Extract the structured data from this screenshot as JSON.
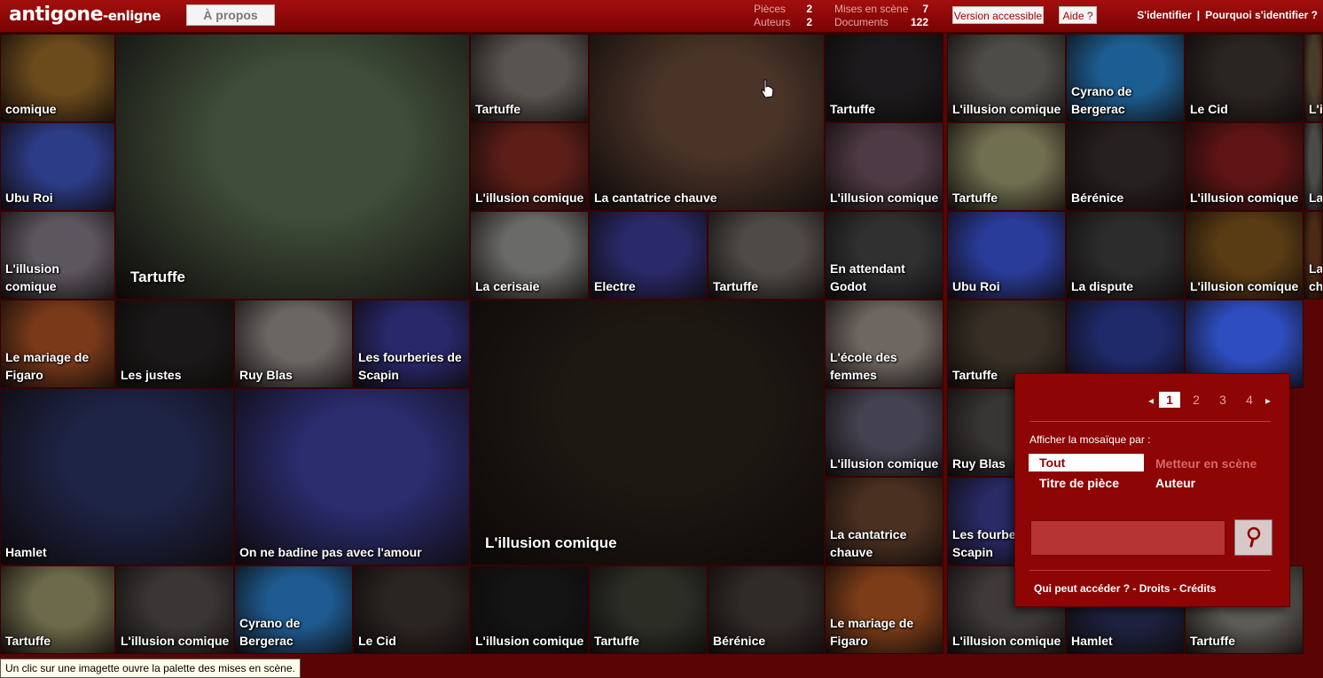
{
  "header": {
    "logo_main": "antigone",
    "logo_suffix": "-enligne",
    "about_button": "À propos",
    "stats": [
      {
        "label": "Pièces",
        "value": "2"
      },
      {
        "label": "Auteurs",
        "value": "2"
      },
      {
        "label": "Mises en scène",
        "value": "7"
      },
      {
        "label": "Documents",
        "value": "122"
      }
    ],
    "accessible_button": "Version accessible",
    "help_button": "Aide ?",
    "login_link": "S'identifier",
    "separator": "|",
    "why_login_link": "Pourquoi s'identifier ?"
  },
  "tiles": [
    {
      "label": "comique",
      "color": "#6b4a1c"
    },
    {
      "label": "Tartuffe",
      "color": "#3f4d39"
    },
    {
      "label": "Tartuffe",
      "color": "#5a5450"
    },
    {
      "label": "La cantatrice chauve",
      "color": "#4a3428"
    },
    {
      "label": "Tartuffe",
      "color": "#1c1a1c"
    },
    {
      "label": "L'illusion comique",
      "color": "#4e4c48"
    },
    {
      "label": "Cyrano de Bergerac",
      "color": "#1d5e92"
    },
    {
      "label": "Le Cid",
      "color": "#2a2422"
    },
    {
      "label": "L'i",
      "color": "#4a3c2a"
    },
    {
      "label": "Ubu Roi",
      "color": "#2d3c86"
    },
    {
      "label": "L'illusion comique",
      "color": "#5e1e18"
    },
    {
      "label": "L'illusion comique",
      "color": "#4e3a44"
    },
    {
      "label": "Tartuffe",
      "color": "#6e7050"
    },
    {
      "label": "Bérénice",
      "color": "#262020"
    },
    {
      "label": "L'illusion comique",
      "color": "#5e1414"
    },
    {
      "label": "La",
      "color": "#4a4a48"
    },
    {
      "label": "L'illusion comique",
      "color": "#5c565e"
    },
    {
      "label": "La cerisaie",
      "color": "#6a6a68"
    },
    {
      "label": "Electre",
      "color": "#2a2a6a"
    },
    {
      "label": "Tartuffe",
      "color": "#4e4a46"
    },
    {
      "label": "En attendant Godot",
      "color": "#303030"
    },
    {
      "label": "Ubu Roi",
      "color": "#2a3c9a"
    },
    {
      "label": "La dispute",
      "color": "#2c2c2c"
    },
    {
      "label": "L'illusion comique",
      "color": "#5a3c14"
    },
    {
      "label": "La ch",
      "color": "#4a2a14"
    },
    {
      "label": "Le mariage de Figaro",
      "color": "#7a3a1a"
    },
    {
      "label": "Les justes",
      "color": "#1a1818"
    },
    {
      "label": "Ruy Blas",
      "color": "#6a6664"
    },
    {
      "label": "Les fourberies de Scapin",
      "color": "#28286a"
    },
    {
      "label": "L'illusion comique",
      "color": "#1e1812"
    },
    {
      "label": "L'école des femmes",
      "color": "#6e6660"
    },
    {
      "label": "Tartuffe",
      "color": "#383026"
    },
    {
      "label": "",
      "color": "#1e2a6a"
    },
    {
      "label": "",
      "color": "#2e4ec0"
    },
    {
      "label": "Hamlet",
      "color": "#1e2446"
    },
    {
      "label": "On ne badine pas avec l'amour",
      "color": "#2a2c6e"
    },
    {
      "label": "L'illusion comique",
      "color": "#444250"
    },
    {
      "label": "Ruy Blas",
      "color": "#383634"
    },
    {
      "label": "La cantatrice chauve",
      "color": "#4a3020"
    },
    {
      "label": "Les fourberies de Scapin",
      "color": "#2a2a66"
    },
    {
      "label": "Tartuffe",
      "color": "#6c6a4a"
    },
    {
      "label": "L'illusion comique",
      "color": "#3a3636"
    },
    {
      "label": "Cyrano de Bergerac",
      "color": "#1e5a90"
    },
    {
      "label": "Le Cid",
      "color": "#2a2422"
    },
    {
      "label": "L'illusion comique",
      "color": "#141414"
    },
    {
      "label": "Tartuffe",
      "color": "#2c2e26"
    },
    {
      "label": "Bérénice",
      "color": "#302a28"
    },
    {
      "label": "Le mariage de Figaro",
      "color": "#7c3c18"
    },
    {
      "label": "L'illusion comique",
      "color": "#3e3a3a"
    },
    {
      "label": "Hamlet",
      "color": "#1e2240"
    },
    {
      "label": "Tartuffe",
      "color": "#5e5c56"
    }
  ],
  "palette": {
    "pages": [
      "1",
      "2",
      "3",
      "4"
    ],
    "active_page": "1",
    "prev_arrow": "◂",
    "next_arrow": "▸",
    "display_by_label": "Afficher la mosaïque par :",
    "options": {
      "all": "Tout",
      "director": "Metteur en scène",
      "title": "Titre de pièce",
      "author": "Auteur"
    },
    "selected_option": "Tout",
    "search_value": "",
    "links": {
      "who": "Qui peut accéder ?",
      "rights": "Droits",
      "credits": "Crédits",
      "sep": " - "
    }
  },
  "status_text": "Un clic sur une imagette ouvre la palette des mises en scène."
}
